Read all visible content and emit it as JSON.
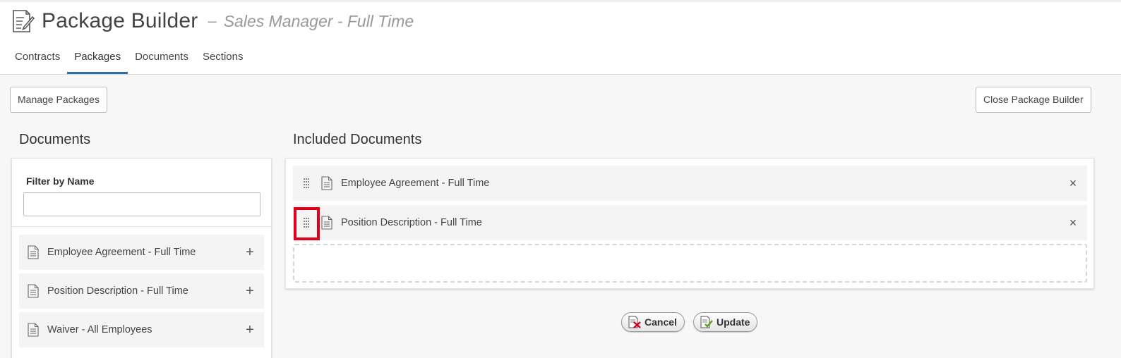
{
  "header": {
    "title": "Package Builder",
    "dash": "–",
    "subtitle": "Sales Manager - Full Time",
    "icon": "document-edit-icon"
  },
  "tabs": [
    {
      "label": "Contracts",
      "active": false
    },
    {
      "label": "Packages",
      "active": true
    },
    {
      "label": "Documents",
      "active": false
    },
    {
      "label": "Sections",
      "active": false
    }
  ],
  "toolbar": {
    "manage_label": "Manage Packages",
    "close_label": "Close Package Builder"
  },
  "documents": {
    "heading": "Documents",
    "filter_label": "Filter by Name",
    "filter_value": "",
    "items": [
      {
        "label": "Employee Agreement - Full Time",
        "icon": "document-icon",
        "action_icon": "plus-icon"
      },
      {
        "label": "Position Description - Full Time",
        "icon": "document-icon",
        "action_icon": "plus-icon"
      },
      {
        "label": "Waiver - All Employees",
        "icon": "document-icon",
        "action_icon": "plus-icon"
      }
    ],
    "plus": "+"
  },
  "included": {
    "heading": "Included Documents",
    "items": [
      {
        "label": "Employee Agreement - Full Time",
        "icon": "document-icon",
        "handle_icon": "drag-handle-icon"
      },
      {
        "label": "Position Description - Full Time",
        "icon": "document-icon",
        "handle_icon": "drag-handle-icon"
      }
    ],
    "remove": "×",
    "highlight_color": "#e0001b"
  },
  "actions": {
    "cancel_label": "Cancel",
    "update_label": "Update"
  },
  "colors": {
    "accent": "#2e6da4"
  }
}
